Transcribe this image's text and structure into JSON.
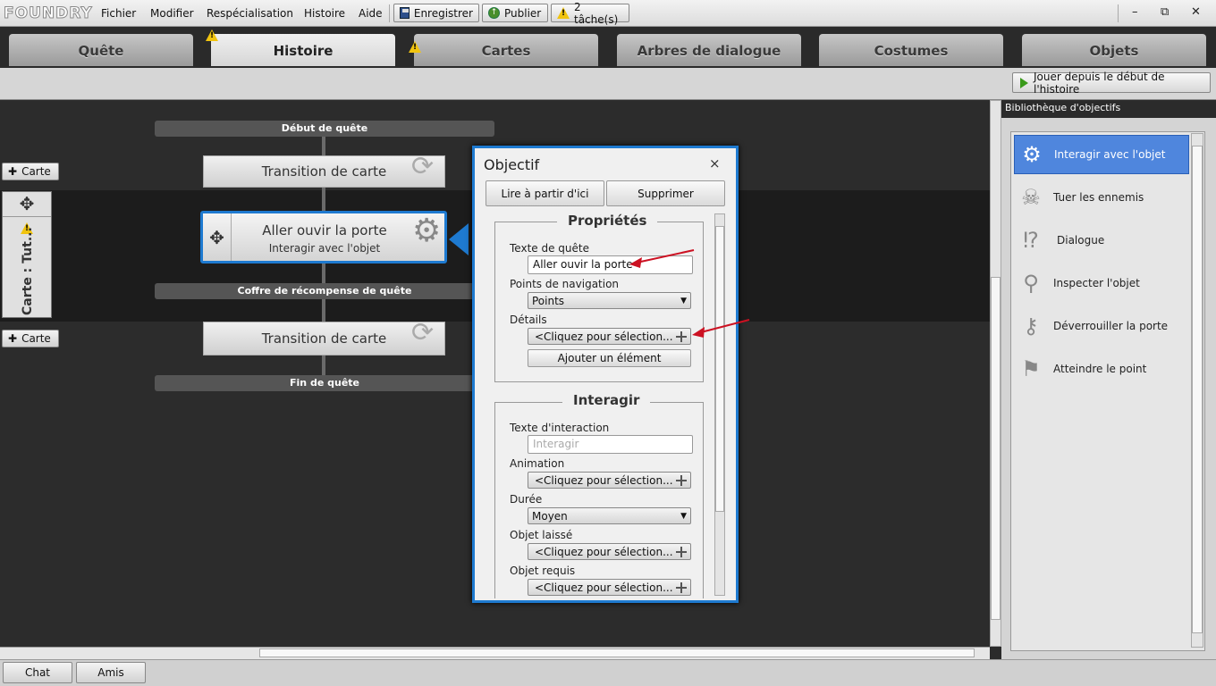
{
  "app": {
    "logo": "FOUNDRY"
  },
  "menu": [
    "Fichier",
    "Modifier",
    "Respécialisation",
    "Histoire",
    "Aide"
  ],
  "toolbar": {
    "save_label": "Enregistrer",
    "publish_label": "Publier",
    "tasks_label": "2 tâche(s)"
  },
  "window": {
    "minimize": "–",
    "restore": "⧉",
    "close": "✕"
  },
  "tabs": [
    {
      "label": "Quête"
    },
    {
      "label": "Histoire"
    },
    {
      "label": "Cartes"
    },
    {
      "label": "Arbres de dialogue"
    },
    {
      "label": "Costumes"
    },
    {
      "label": "Objets"
    }
  ],
  "play_button": "Jouer depuis le début de l'histoire",
  "flow": {
    "start": "Début de quête",
    "transition1": "Transition de carte",
    "objective_title": "Aller ouvir la porte",
    "objective_sub": "Interagir avec l'objet",
    "reward": "Coffre de récompense de quête",
    "transition2": "Transition de carte",
    "end": "Fin de quête",
    "add_map": "Carte",
    "map_label": "Carte : Tut..."
  },
  "panel": {
    "title": "Objectif",
    "close": "×",
    "read_from_here": "Lire à partir d'ici",
    "delete": "Supprimer",
    "properties": {
      "legend": "Propriétés",
      "quest_text_label": "Texte de quête",
      "quest_text_value": "Aller ouvir la porte",
      "waypoints_label": "Points de navigation",
      "waypoints_value": "Points",
      "details_label": "Détails",
      "details_value": "<Cliquez pour sélection...",
      "add_item": "Ajouter un élément"
    },
    "interact": {
      "legend": "Interagir",
      "interaction_text_label": "Texte d'interaction",
      "interaction_text_placeholder": "Interagir",
      "animation_label": "Animation",
      "animation_value": "<Cliquez pour sélection...",
      "duration_label": "Durée",
      "duration_value": "Moyen",
      "dropped_item_label": "Objet laissé",
      "dropped_item_value": "<Cliquez pour sélection...",
      "required_item_label": "Objet requis",
      "required_item_value": "<Cliquez pour sélection..."
    }
  },
  "library": {
    "title": "Bibliothèque d'objectifs",
    "items": [
      {
        "label": "Interagir avec l'objet",
        "icon": "gear-icon"
      },
      {
        "label": "Tuer les ennemis",
        "icon": "skull-icon"
      },
      {
        "label": "Dialogue",
        "icon": "dialogue-icon"
      },
      {
        "label": "Inspecter l'objet",
        "icon": "magnifier-icon"
      },
      {
        "label": "Déverrouiller la porte",
        "icon": "key-icon"
      },
      {
        "label": "Atteindre le point",
        "icon": "flag-icon"
      }
    ]
  },
  "bottom": {
    "chat": "Chat",
    "friends": "Amis"
  },
  "colors": {
    "accent": "#4f86dd",
    "panel_border": "#1e7ad0",
    "annotation_arrow": "#cc1122"
  }
}
